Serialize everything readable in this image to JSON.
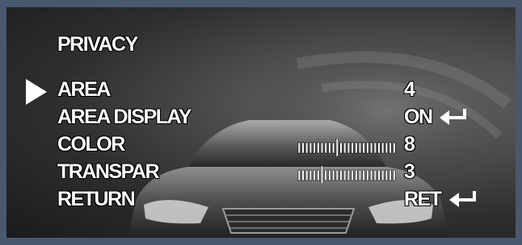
{
  "menu": {
    "title": "PRIVACY",
    "items": [
      {
        "label": "AREA",
        "value": "4"
      },
      {
        "label": "AREA DISPLAY",
        "value": "ON"
      },
      {
        "label": "COLOR",
        "value": "8"
      },
      {
        "label": "TRANSPAR",
        "value": "3"
      },
      {
        "label": "RETURN",
        "value": "RET"
      }
    ],
    "selected_index": 0
  },
  "sliders": {
    "color_level": 0.4,
    "transparency_level": 0.22
  },
  "icons": {
    "cursor": "right-triangle-icon",
    "enter": "enter-arrow-icon"
  },
  "colors": {
    "border": "#48586e",
    "text": "#ffffff"
  }
}
